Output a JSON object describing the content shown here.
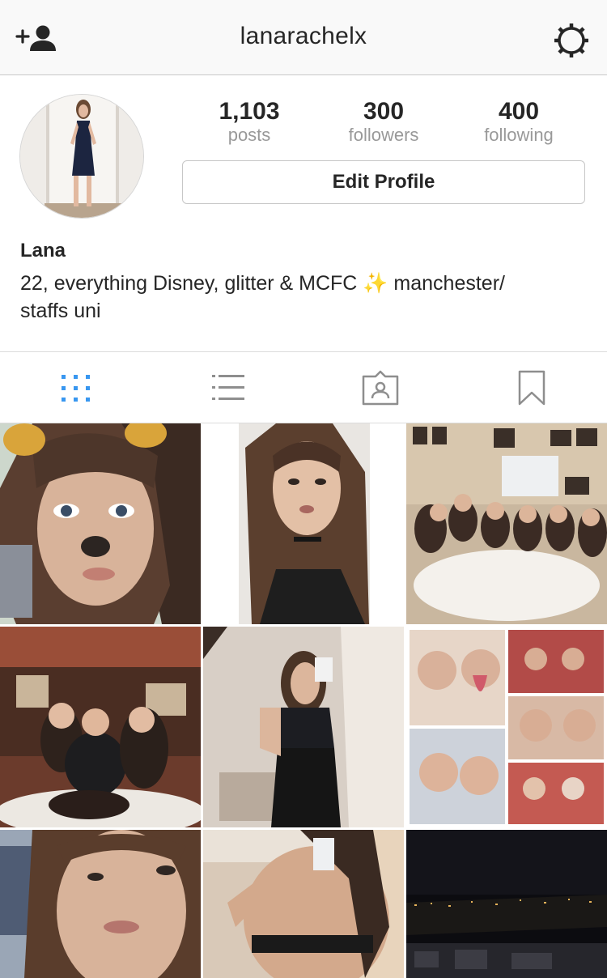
{
  "header": {
    "username": "lanarachelx",
    "left_icon": "add-user-icon",
    "right_icon": "settings-gear-icon"
  },
  "profile": {
    "stats": [
      {
        "count": "1,103",
        "label": "posts"
      },
      {
        "count": "300",
        "label": "followers"
      },
      {
        "count": "400",
        "label": "following"
      }
    ],
    "edit_button_label": "Edit Profile",
    "name": "Lana",
    "bio_part1": "22, everything Disney, glitter & MCFC",
    "bio_emoji": "✨",
    "bio_part2": "manchester/",
    "bio_line2": "staffs uni"
  },
  "tabs": [
    {
      "icon": "grid-view-icon",
      "active": true
    },
    {
      "icon": "list-view-icon",
      "active": false
    },
    {
      "icon": "tagged-photos-icon",
      "active": false
    },
    {
      "icon": "saved-bookmark-icon",
      "active": false
    }
  ],
  "colors": {
    "accent_blue": "#3897f0",
    "text": "#262626",
    "muted": "#999999"
  }
}
